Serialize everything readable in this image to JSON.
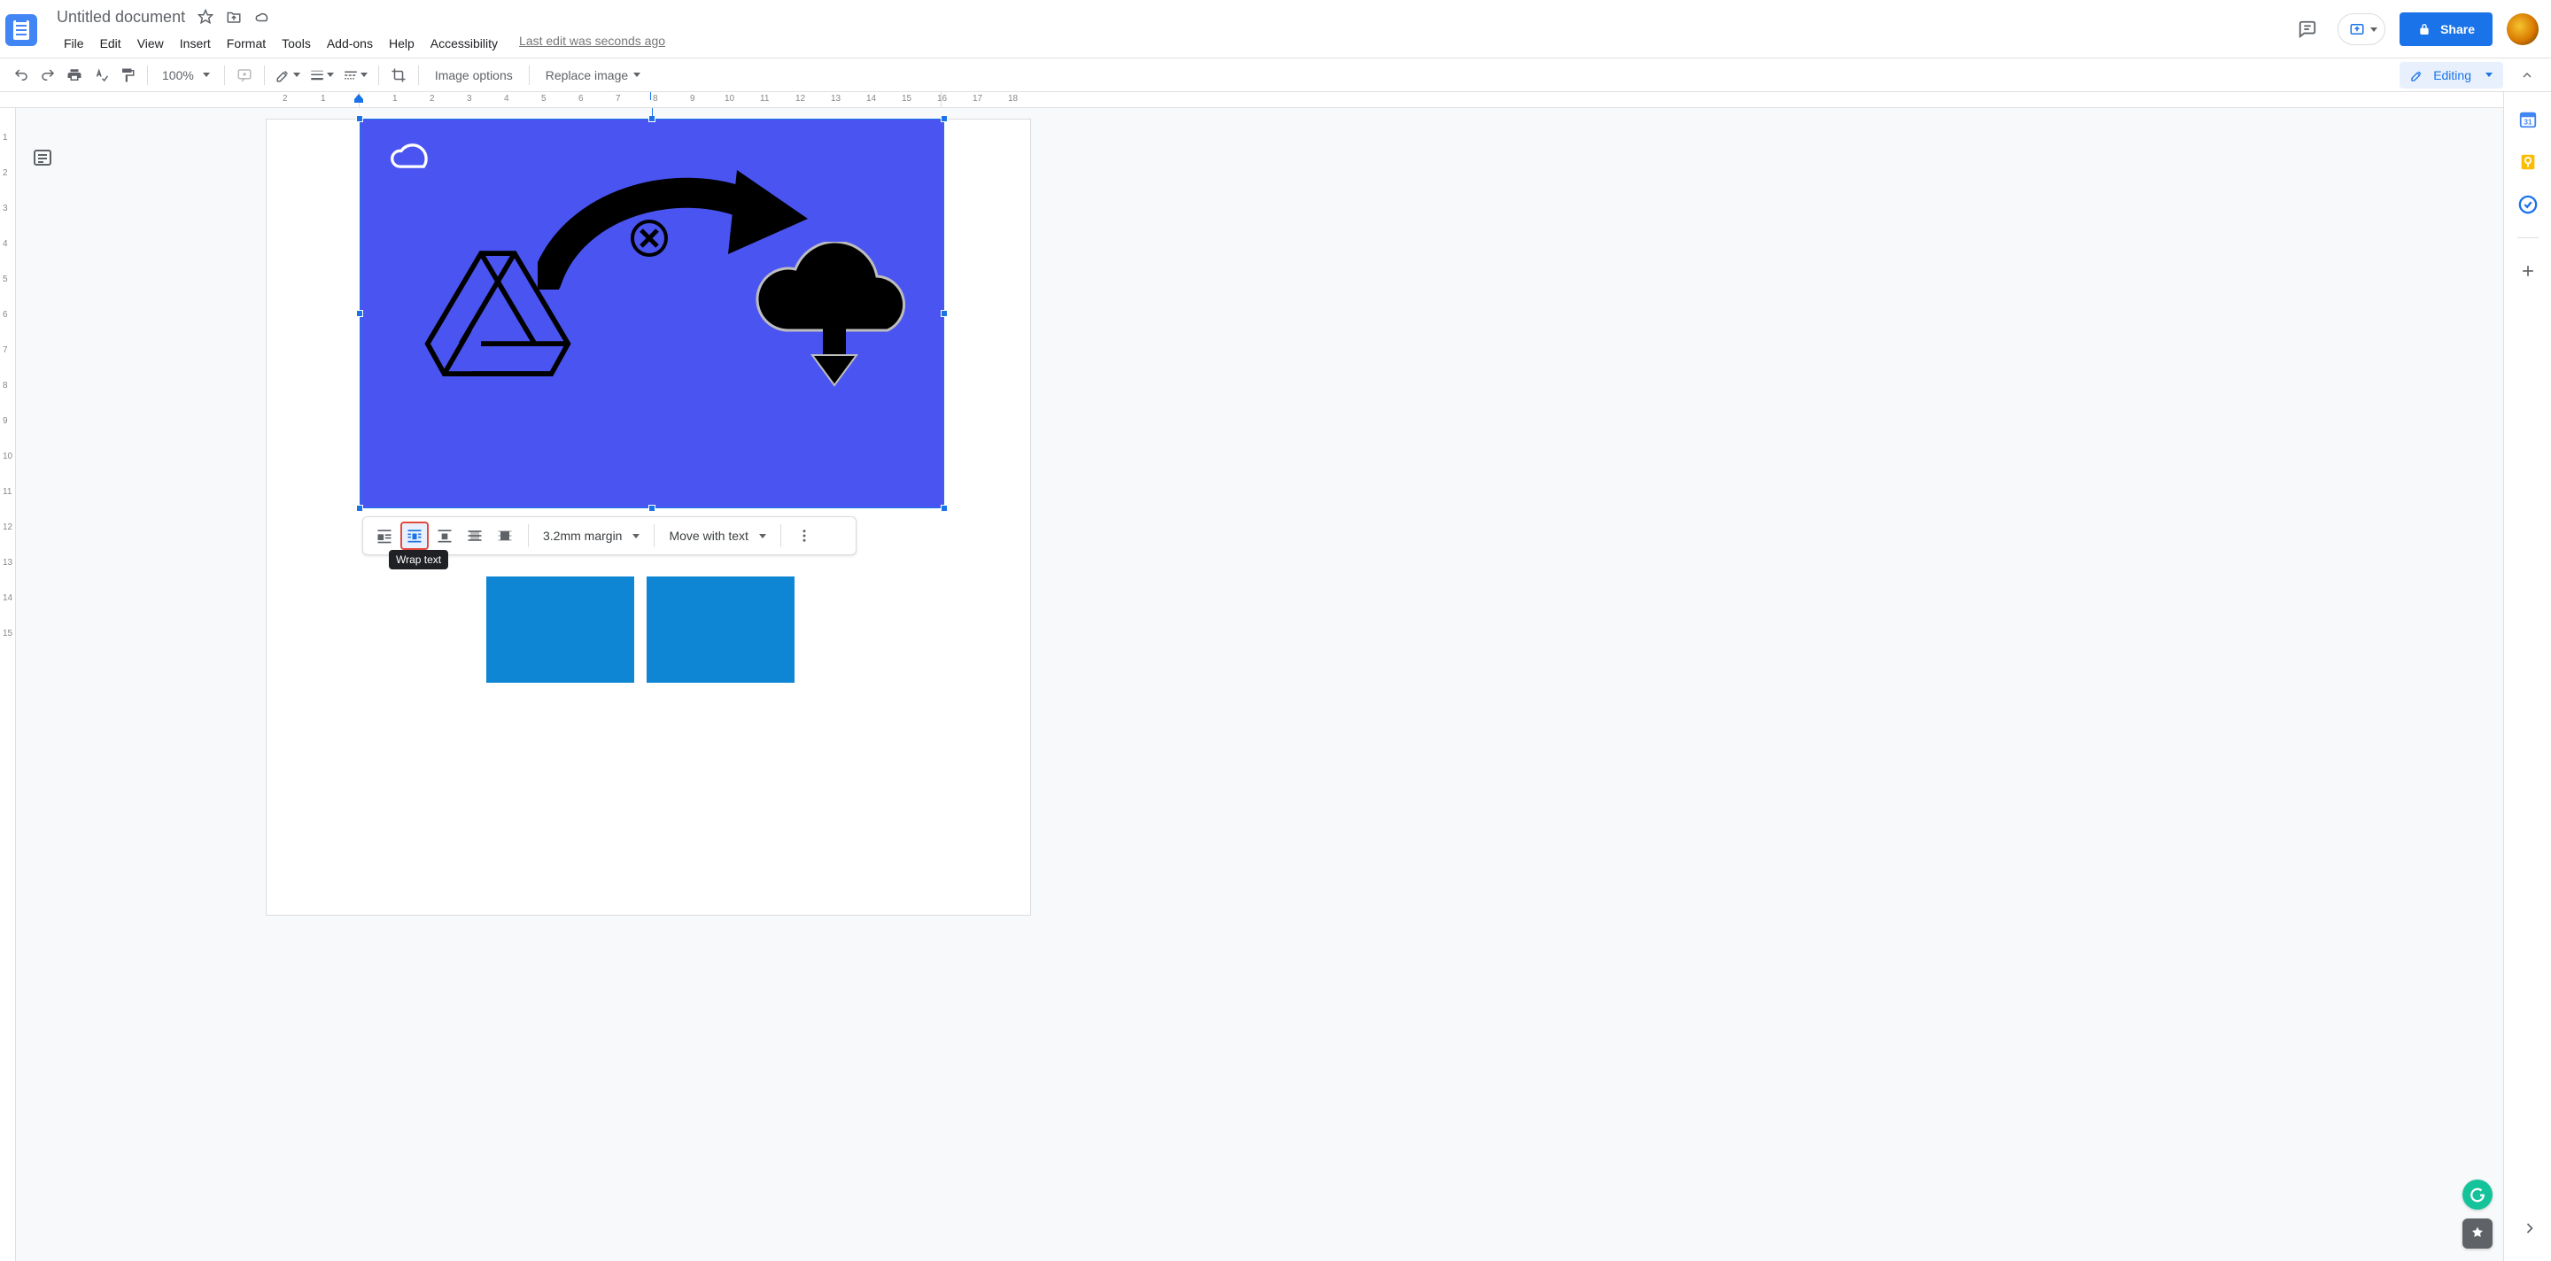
{
  "doc": {
    "title": "Untitled document",
    "last_edit": "Last edit was seconds ago"
  },
  "menubar": {
    "items": [
      "File",
      "Edit",
      "View",
      "Insert",
      "Format",
      "Tools",
      "Add-ons",
      "Help",
      "Accessibility"
    ]
  },
  "header_right": {
    "share_label": "Share"
  },
  "toolbar": {
    "zoom": "100%",
    "image_options": "Image options",
    "replace_image": "Replace image",
    "editing": "Editing"
  },
  "hruler": {
    "nums": [
      "2",
      "1",
      "",
      "1",
      "2",
      "3",
      "4",
      "5",
      "6",
      "7",
      "8",
      "9",
      "10",
      "11",
      "12",
      "13",
      "14",
      "15",
      "16",
      "17",
      "18"
    ]
  },
  "float_toolbar": {
    "wrap_options": [
      "in-line",
      "wrap-text",
      "break-text",
      "behind-text",
      "in-front-of-text"
    ],
    "active_index": 1,
    "margin_label": "3.2mm margin",
    "move_label": "Move with text",
    "tooltip": "Wrap text"
  },
  "side_panel": {
    "icons": [
      "calendar",
      "keep",
      "tasks"
    ]
  },
  "colors": {
    "accent": "#1a73e8",
    "image_bg": "#4a54f1",
    "small_sq": "#0e86d4"
  }
}
